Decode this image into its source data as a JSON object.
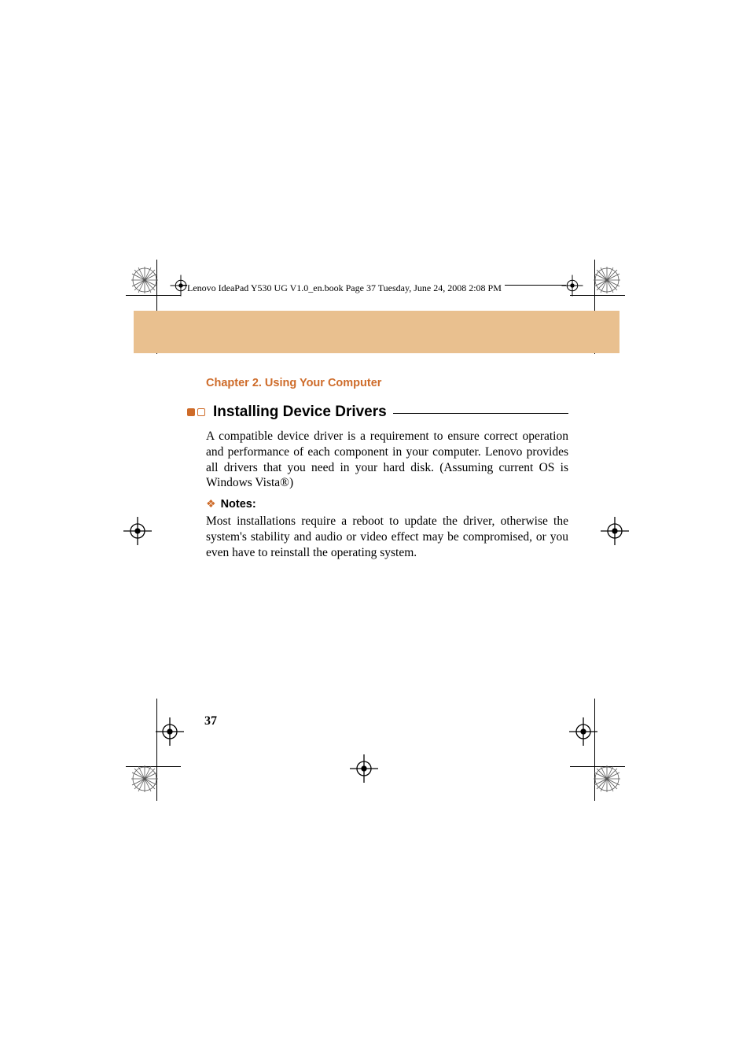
{
  "book_header": "Lenovo IdeaPad Y530 UG V1.0_en.book  Page 37  Tuesday, June 24, 2008  2:08 PM",
  "chapter_title": "Chapter 2. Using Your Computer",
  "section_heading": "Installing Device Drivers",
  "body_paragraph": "A compatible device driver is a requirement to ensure correct operation and performance of each component in your computer. Lenovo provides all drivers that you need in your hard disk. (Assuming current OS is Windows Vista®)",
  "notes_label": "Notes:",
  "notes_paragraph": "Most installations require a reboot to update the driver, otherwise the system's stability and audio or video effect may be compromised, or you even have to reinstall the operating system.",
  "page_number": "37"
}
